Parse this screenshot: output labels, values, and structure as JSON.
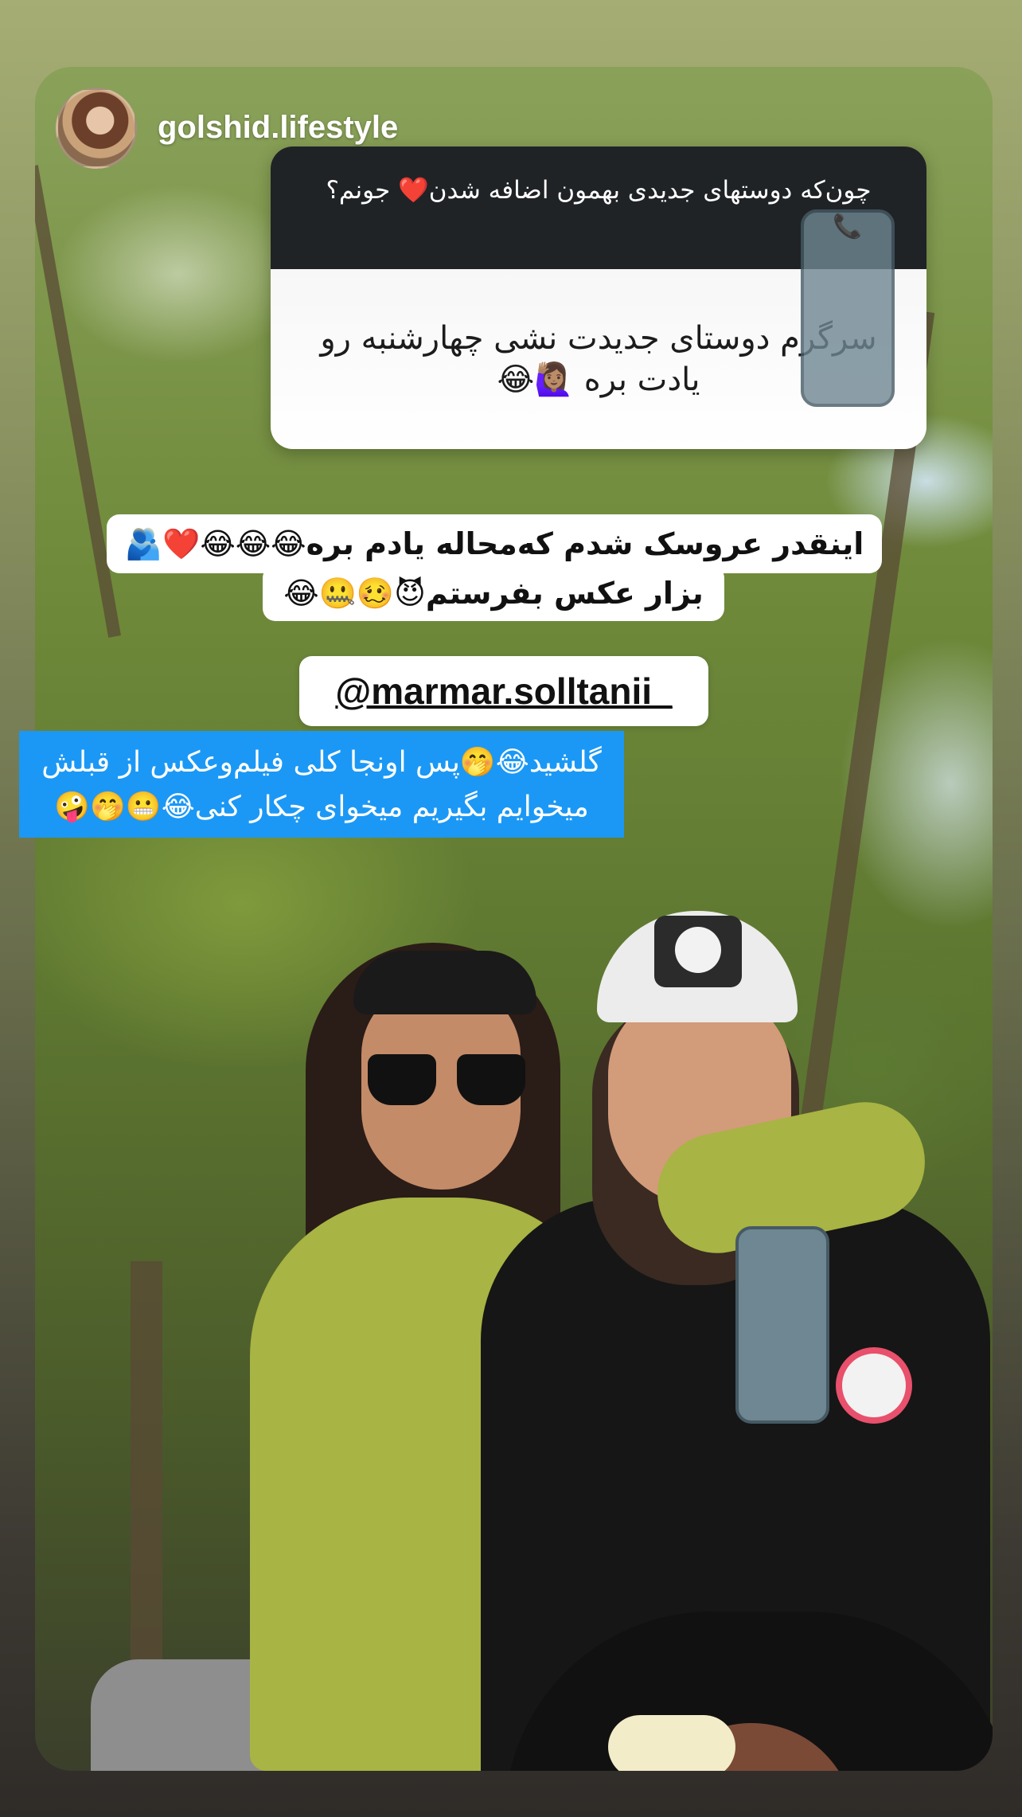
{
  "header": {
    "username": "golshid.lifestyle"
  },
  "question_sticker": {
    "question": "چون‌که دوستهای جدیدی بهمون اضافه شدن❤️ جونم؟",
    "question_icon": "📞",
    "answer": "سرگرم دوستای جدیدت نشی چهارشنبه رو یادت بره 🙋🏽‍♀️😂"
  },
  "caption": {
    "line1": "اینقدر عروسک شدم که‌محاله یادم بره😂😂😂❤️🫂",
    "line2": "بزار عکس بفرستم😈🥴🤐😂"
  },
  "mention": {
    "text": "@marmar.solltanii_"
  },
  "reply_text": {
    "line1": "گلشید😂🤭پس اونجا کلی فیلم‌وعکس از قبلش",
    "line2": "میخوایم بگیریم میخوای چکار کنی😂😬🤭🤪"
  },
  "colors": {
    "reply_background": "#1b98f5",
    "question_header": "#202326"
  }
}
